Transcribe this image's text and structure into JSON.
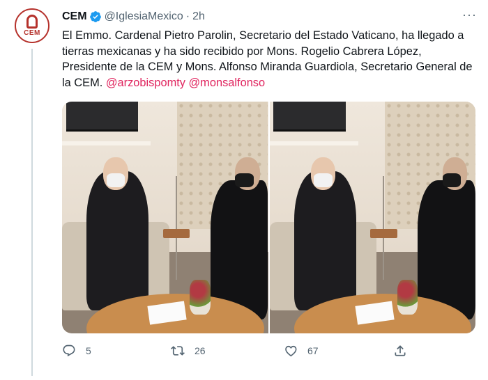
{
  "tweet": {
    "avatar_text": "CEM",
    "name": "CEM",
    "handle": "@IglesiaMexico",
    "separator": "·",
    "time": "2h",
    "more": "···",
    "text": "El Emmo. Cardenal Pietro Parolin, Secretario del Estado Vaticano,  ha llegado a tierras mexicanas y ha sido recibido por Mons. Rogelio Cabrera López, Presidente de la CEM y Mons. Alfonso Miranda Guardiola, Secretario General de la CEM.",
    "mentions": [
      "@arzobispomty",
      "@monsalfonso"
    ]
  },
  "actions": {
    "replies": "5",
    "retweets": "26",
    "likes": "67"
  },
  "colors": {
    "mention": "#e0245e",
    "verified": "#1d9bf0",
    "muted": "#536471",
    "brand": "#b5312b"
  },
  "icons": {
    "verified": "verified-badge-icon",
    "reply": "reply-icon",
    "retweet": "retweet-icon",
    "like": "heart-icon",
    "share": "share-icon"
  }
}
